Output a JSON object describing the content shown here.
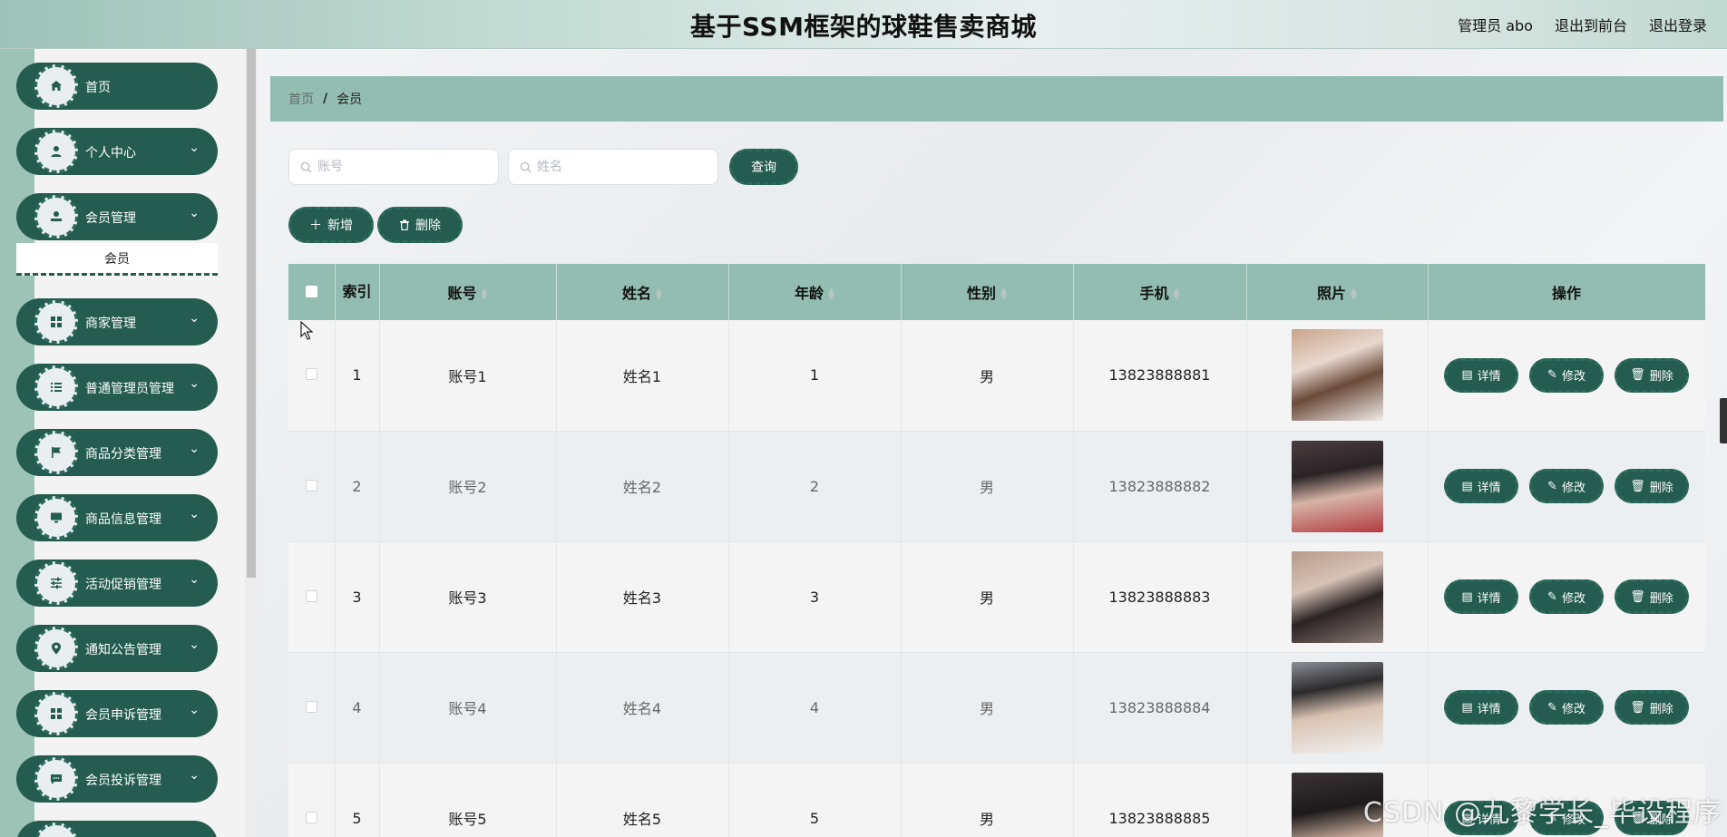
{
  "header": {
    "title": "基于SSM框架的球鞋售卖商城",
    "admin_label": "管理员 abo",
    "front_label": "退出到前台",
    "logout_label": "退出登录"
  },
  "sidebar": {
    "items": [
      {
        "label": "首页",
        "icon": "home-icon"
      },
      {
        "label": "个人中心",
        "icon": "user-icon"
      },
      {
        "label": "会员管理",
        "icon": "member-icon"
      },
      {
        "label": "商家管理",
        "icon": "grid-icon"
      },
      {
        "label": "普通管理员管理",
        "icon": "list-icon"
      },
      {
        "label": "商品分类管理",
        "icon": "flag-icon"
      },
      {
        "label": "商品信息管理",
        "icon": "monitor-icon"
      },
      {
        "label": "活动促销管理",
        "icon": "sliders-icon"
      },
      {
        "label": "通知公告管理",
        "icon": "location-icon"
      },
      {
        "label": "会员申诉管理",
        "icon": "grid-icon"
      },
      {
        "label": "会员投诉管理",
        "icon": "message-icon"
      }
    ],
    "submenu_label": "会员"
  },
  "breadcrumb": {
    "home": "首页",
    "separator": "/",
    "current": "会员"
  },
  "search": {
    "account_placeholder": "账号",
    "name_placeholder": "姓名",
    "query_label": "查询"
  },
  "toolbar": {
    "add_label": "新增",
    "delete_label": "删除"
  },
  "table": {
    "headers": {
      "index": "索引",
      "account": "账号",
      "name": "姓名",
      "age": "年龄",
      "gender": "性别",
      "phone": "手机",
      "photo": "照片",
      "actions": "操作"
    },
    "rows": [
      {
        "index": "1",
        "account": "账号1",
        "name": "姓名1",
        "age": "1",
        "gender": "男",
        "phone": "13823888881"
      },
      {
        "index": "2",
        "account": "账号2",
        "name": "姓名2",
        "age": "2",
        "gender": "男",
        "phone": "13823888882"
      },
      {
        "index": "3",
        "account": "账号3",
        "name": "姓名3",
        "age": "3",
        "gender": "男",
        "phone": "13823888883"
      },
      {
        "index": "4",
        "account": "账号4",
        "name": "姓名4",
        "age": "4",
        "gender": "男",
        "phone": "13823888884"
      },
      {
        "index": "5",
        "account": "账号5",
        "name": "姓名5",
        "age": "5",
        "gender": "男",
        "phone": "13823888885"
      }
    ],
    "row_actions": {
      "detail": "详情",
      "edit": "修改",
      "delete": "删除"
    }
  },
  "watermark": "CSDN @九黎学长_毕设程序",
  "colors": {
    "primary": "#245c4f",
    "header_bg": "#93bdb0",
    "sidebar_bg": "#9cc3b6"
  }
}
